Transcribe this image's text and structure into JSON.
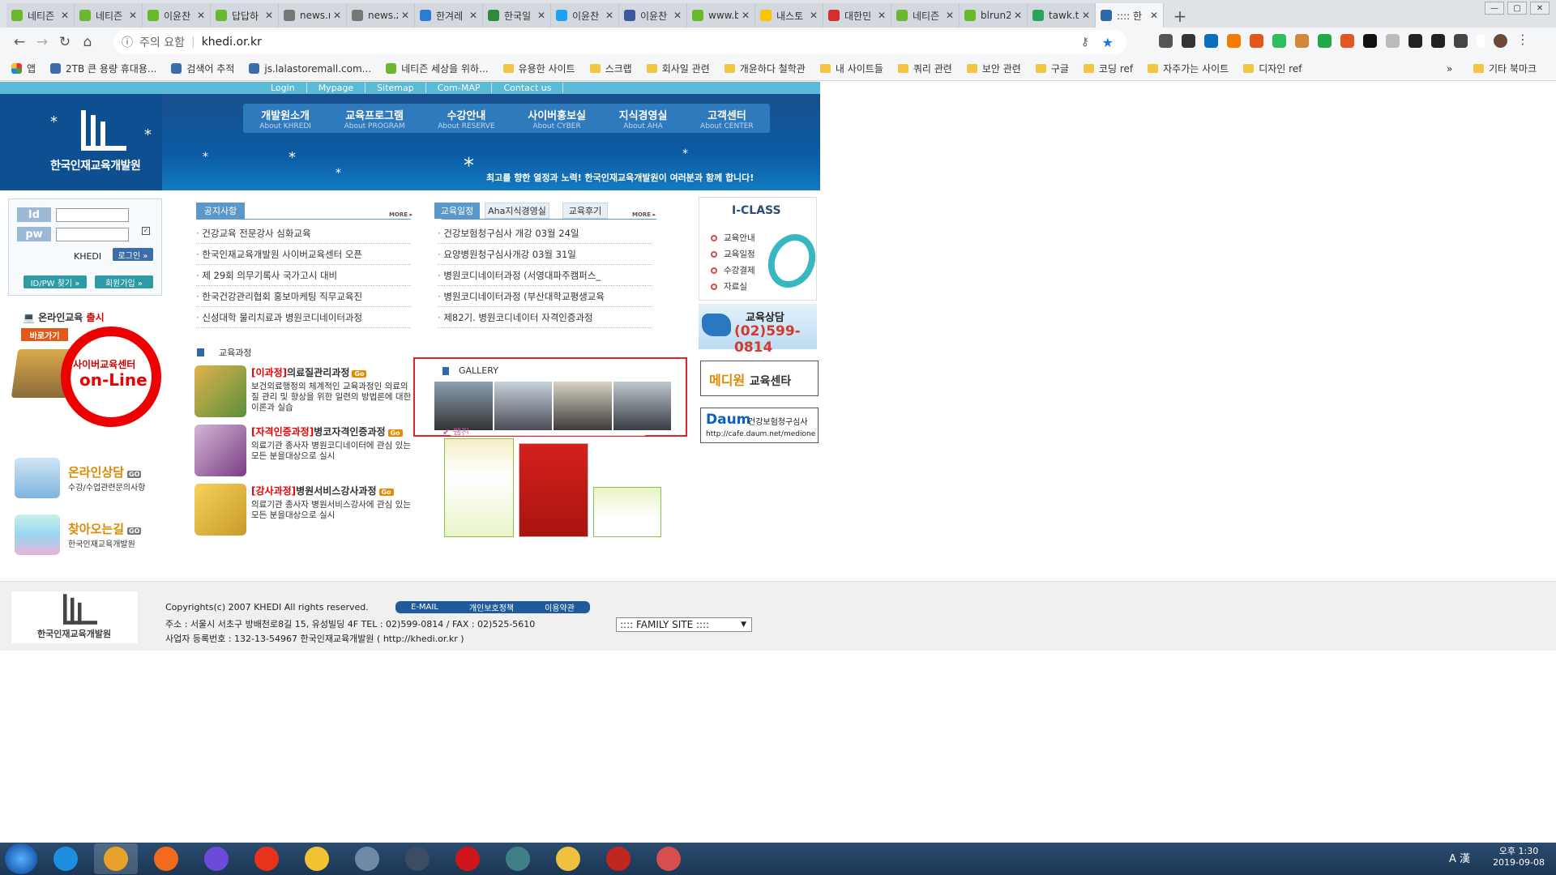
{
  "browser": {
    "tabs": [
      {
        "label": "네티즌",
        "color": "#6ab82d"
      },
      {
        "label": "네티즌",
        "color": "#6ab82d"
      },
      {
        "label": "이윤찬",
        "color": "#6ab82d"
      },
      {
        "label": "답답하",
        "color": "#6ab82d"
      },
      {
        "label": "news.n",
        "color": "#777777"
      },
      {
        "label": "news.z",
        "color": "#777777"
      },
      {
        "label": "한겨레",
        "color": "#2e7bd3"
      },
      {
        "label": "한국일",
        "color": "#2d8a3e"
      },
      {
        "label": "이윤찬",
        "color": "#1da1f2"
      },
      {
        "label": "이윤찬",
        "color": "#3b5998"
      },
      {
        "label": "www.b",
        "color": "#6ab82d"
      },
      {
        "label": "내스토",
        "color": "#f7c600"
      },
      {
        "label": "대한민",
        "color": "#d62e2e"
      },
      {
        "label": "네티즌",
        "color": "#6ab82d"
      },
      {
        "label": "blrun2",
        "color": "#6ab82d"
      },
      {
        "label": "tawk.to",
        "color": "#2aa45a"
      },
      {
        "label": ":::: 한",
        "color": "#2d6aa7"
      }
    ],
    "secure_label": "주의 요함",
    "url": "khedi.or.kr",
    "bookmarks": [
      {
        "label": "앱",
        "type": "apps"
      },
      {
        "label": "2TB 큰 용량 휴대용...",
        "type": "site"
      },
      {
        "label": "검색어 추적",
        "type": "site"
      },
      {
        "label": "js.lalastoremall.com...",
        "type": "site"
      },
      {
        "label": "네티즌 세상을 위하...",
        "type": "site"
      },
      {
        "label": "유용한 사이트",
        "type": "folder"
      },
      {
        "label": "스크랩",
        "type": "folder"
      },
      {
        "label": "회사일 관련",
        "type": "folder"
      },
      {
        "label": "개윤하다 철학관",
        "type": "folder"
      },
      {
        "label": "내 사이트들",
        "type": "folder"
      },
      {
        "label": "쿼리 관련",
        "type": "folder"
      },
      {
        "label": "보안 관련",
        "type": "folder"
      },
      {
        "label": "구글",
        "type": "folder"
      },
      {
        "label": "코딩 ref",
        "type": "folder"
      },
      {
        "label": "자주가는 사이트",
        "type": "folder"
      },
      {
        "label": "디자인 ref",
        "type": "folder"
      }
    ],
    "bookmarks_more": "»",
    "other_bookmarks": "기타 북마크"
  },
  "site": {
    "topnav": [
      "Login",
      "Mypage",
      "Sitemap",
      "Com-MAP",
      "Contact us"
    ],
    "logo_text": "한국인재교육개발원",
    "gnb": [
      {
        "ko": "개발원소개",
        "en": "About KHREDI"
      },
      {
        "ko": "교육프로그램",
        "en": "About PROGRAM"
      },
      {
        "ko": "수강안내",
        "en": "About RESERVE"
      },
      {
        "ko": "사이버홍보실",
        "en": "About CYBER"
      },
      {
        "ko": "지식경영실",
        "en": "About AHA"
      },
      {
        "ko": "고객센터",
        "en": "About CENTER"
      }
    ],
    "slogan": "최고를 향한 열정과 노력! 한국인재교육개발원이 여러분과 함께 합니다!",
    "login": {
      "id_label": "Id",
      "pw_label": "pw",
      "khedi": "KHEDI",
      "login_btn": "로그인 »",
      "find_btn": "ID/PW 찾기 »",
      "join_btn": "회원가입 »"
    },
    "promos": {
      "online_prefix": "온라인교육",
      "online_suffix": "출시",
      "goto": "바로가기",
      "cyber_center": "사이버교육센터",
      "cyber_online": "on-Line",
      "counsel_title": "온라인상담",
      "counsel_sub": "수강/수업관련문의사항",
      "map_title": "찾아오는길",
      "map_sub": "한국인재교육개발원",
      "go": "GO"
    },
    "notice": {
      "tab": "공지사항",
      "more": "MORE ▸",
      "items": [
        "건강교육 전문강사 심화교육",
        "한국인재교육개발원 사이버교육센터 오픈",
        "제 29회 의무기록사 국가고시 대비",
        "한국건강관리협회 홍보마케팅 직무교육진",
        "신성대학 물리치료과 병원코디네이터과정"
      ]
    },
    "schedule": {
      "tabs": [
        "교육일정",
        "Aha지식경영실",
        "교육후기"
      ],
      "more": "MORE ▸",
      "items": [
        "건강보험청구심사 개강 03월 24일",
        "요양병원청구심사개강 03월 31일",
        "병원코디네이터과정 (서영대파주캠퍼스_",
        "병원코디네이터과정 (부산대학교평생교육",
        "제82기. 병원코디네이터 자격인증과정"
      ]
    },
    "courses_head": "교육과정",
    "courses": [
      {
        "tag": "[이과정]",
        "title": "의료질관리과정",
        "go": "Go",
        "desc": "보건의료행정의 체계적인 교육과정인 의료의 질 관리 및 향상을 위한 일련의 방법론에 대한 이론과 실습"
      },
      {
        "tag": "[자격인증과정]",
        "title": "병코자격인증과정",
        "go": "Go",
        "desc": "의료기관 종사자 병원코디네이터에 관심 있는 모든 분을대상으로 실시"
      },
      {
        "tag": "[강사과정]",
        "title": "병원서비스강사과정",
        "go": "Go",
        "desc": "의료기관 종사자 병원서비스강사에 관심 있는 모든 분을대상으로 실시"
      }
    ],
    "gallery_title": "GALLERY",
    "webzine": "웹진",
    "iclass": {
      "title": "I-CLASS",
      "items": [
        "교육안내",
        "교육일정",
        "수강결제",
        "자료실"
      ]
    },
    "consult": {
      "title": "교육상담",
      "phone": "(02)599-0814"
    },
    "mediwon": {
      "a": "메디원",
      "b": "교육센타"
    },
    "daum": {
      "logo": "Daum",
      "text": "건강보험청구심사",
      "url": "http://cafe.daum.net/medione"
    },
    "footer": {
      "logo_text": "한국인재교육개발원",
      "copyright": "Copyrights(c) 2007  KHEDI  All rights reserved.",
      "links": [
        "E-MAIL",
        "개인보호정책",
        "이용약관"
      ],
      "address": "주소 : 서울시 서초구 방배천로8길 15, 유성빌딩 4F TEL : 02)599-0814 / FAX : 02)525-5610",
      "biz": "사업자 등록번호 : 132-13-54967 한국인재교육개발원 ( http://khedi.or.kr )",
      "family_site": ":::: FAMILY SITE ::::"
    }
  },
  "taskbar": {
    "apps": [
      "#1e8fe0",
      "#e8a12a",
      "#f26a1b",
      "#6b4bd8",
      "#e8321c",
      "#f1c232",
      "#6f8aa6",
      "#3c4c63",
      "#d0161c",
      "#3f7f86",
      "#f0c040",
      "#c0281f",
      "#d64e4e"
    ],
    "tray_ime": "A 漢",
    "time": "오후 1:30",
    "date": "2019-09-08"
  }
}
